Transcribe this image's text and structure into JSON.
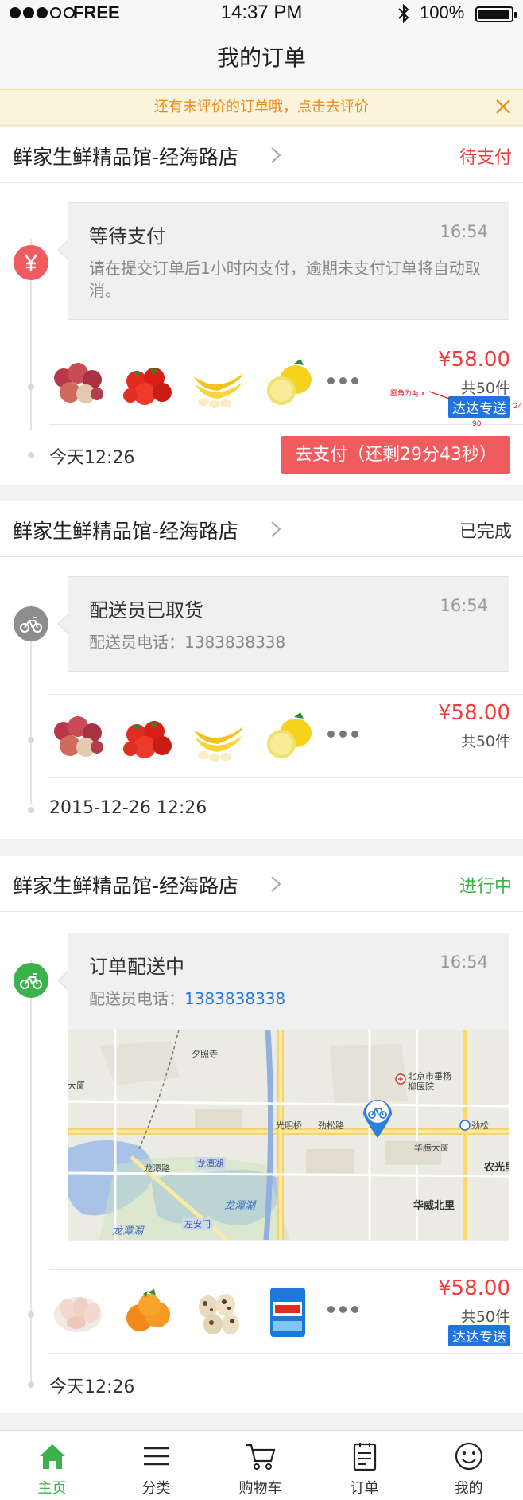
{
  "status_bar": {
    "carrier": "FREE",
    "time": "14:37 PM",
    "battery": "100%"
  },
  "nav": {
    "title": "我的订单"
  },
  "notice": {
    "text": "还有未评价的订单哦，点击去评价"
  },
  "orders": [
    {
      "shop": "鲜家生鲜精品馆-经海路店",
      "state": "待支付",
      "state_color": "#f03a3a",
      "icon": "yen-icon",
      "bubble_title": "等待支付",
      "bubble_time": "16:54",
      "bubble_desc": "请在提交订单后1小时内支付，逾期未支付订单将自动取消。",
      "price": "¥58.00",
      "count": "共50件",
      "badge": "达达专送",
      "footer_time": "今天12:26",
      "pay_button": "去支付（还剩29分43秒）",
      "annotation_radius": "圆角为4px",
      "annotation_width": "90",
      "annotation_height": "24"
    },
    {
      "shop": "鲜家生鲜精品馆-经海路店",
      "state": "已完成",
      "state_color": "#333333",
      "icon": "bicycle-icon",
      "bubble_title": "配送员已取货",
      "bubble_time": "16:54",
      "bubble_desc": "配送员电话：1383838338",
      "price": "¥58.00",
      "count": "共50件",
      "footer_time": "2015-12-26 12:26"
    },
    {
      "shop": "鲜家生鲜精品馆-经海路店",
      "state": "进行中",
      "state_color": "#3cb34a",
      "icon": "bicycle-icon",
      "bubble_title": "订单配送中",
      "bubble_time": "16:54",
      "bubble_phone_label": "配送员电话：",
      "bubble_phone": "1383838338",
      "price": "¥58.00",
      "count": "共50件",
      "badge": "达达专送",
      "footer_time": "今天12:26"
    }
  ],
  "map": {
    "labels": [
      "夕照寺",
      "大厦",
      "北京市垂杨柳医院",
      "光明桥",
      "劲松路",
      "劲松",
      "华腾大厦",
      "农光里",
      "龙潭路",
      "龙潭湖",
      "左安门",
      "龙潭湖",
      "龙潭湖",
      "华威北里"
    ]
  },
  "tabs": [
    {
      "label": "主页",
      "icon": "home-icon"
    },
    {
      "label": "分类",
      "icon": "list-icon"
    },
    {
      "label": "购物车",
      "icon": "cart-icon"
    },
    {
      "label": "订单",
      "icon": "order-icon"
    },
    {
      "label": "我的",
      "icon": "smile-icon"
    }
  ],
  "colors": {
    "accent_green": "#3cb34a",
    "price_red": "#f23a3a",
    "pay_button": "#ef5b5e",
    "badge_blue": "#1f74e0",
    "notice_text": "#f08a1c"
  }
}
